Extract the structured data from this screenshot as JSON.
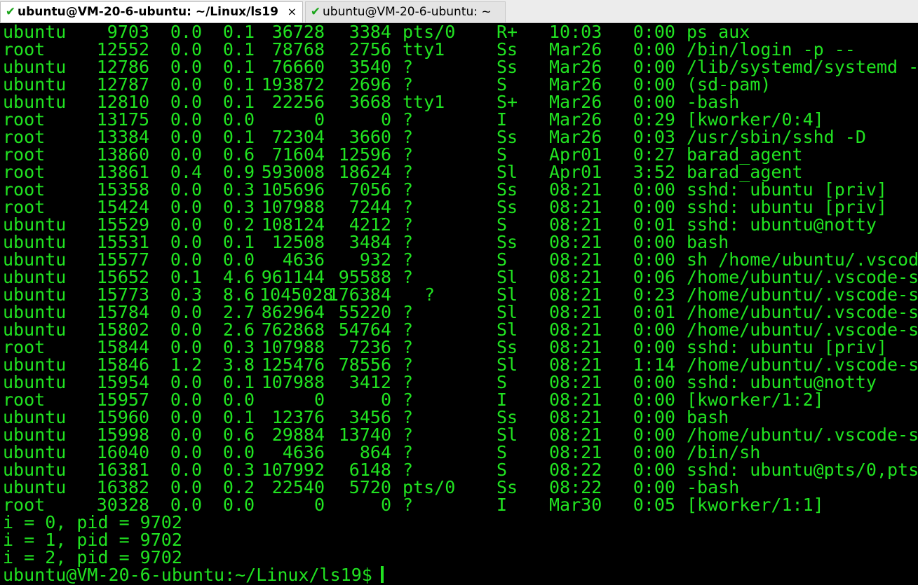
{
  "tabs": [
    {
      "title": "ubuntu@VM-20-6-ubuntu: ~/Linux/ls19",
      "status_icon": "check-icon",
      "close": "×",
      "active": true
    },
    {
      "title": "ubuntu@VM-20-6-ubuntu: ~",
      "status_icon": "check-icon",
      "active": false
    }
  ],
  "colors": {
    "fg": "#21e321",
    "bg": "#000000",
    "tab_check": "#1aa51a"
  },
  "rows": [
    {
      "user": "ubuntu",
      "pid": "9703",
      "cpu": "0.0",
      "mem": "0.1",
      "vsz": "36728",
      "rss": "3384",
      "tty": "pts/0",
      "stat": "R+",
      "start": "10:03",
      "time": "0:00",
      "cmd": "ps aux"
    },
    {
      "user": "root",
      "pid": "12552",
      "cpu": "0.0",
      "mem": "0.1",
      "vsz": "78768",
      "rss": "2756",
      "tty": "tty1",
      "stat": "Ss",
      "start": "Mar26",
      "time": "0:00",
      "cmd": "/bin/login -p --"
    },
    {
      "user": "ubuntu",
      "pid": "12786",
      "cpu": "0.0",
      "mem": "0.1",
      "vsz": "76660",
      "rss": "3540",
      "tty": "?",
      "stat": "Ss",
      "start": "Mar26",
      "time": "0:00",
      "cmd": "/lib/systemd/systemd -"
    },
    {
      "user": "ubuntu",
      "pid": "12787",
      "cpu": "0.0",
      "mem": "0.1",
      "vsz": "193872",
      "rss": "2696",
      "tty": "?",
      "stat": "S",
      "start": "Mar26",
      "time": "0:00",
      "cmd": "(sd-pam)"
    },
    {
      "user": "ubuntu",
      "pid": "12810",
      "cpu": "0.0",
      "mem": "0.1",
      "vsz": "22256",
      "rss": "3668",
      "tty": "tty1",
      "stat": "S+",
      "start": "Mar26",
      "time": "0:00",
      "cmd": "-bash"
    },
    {
      "user": "root",
      "pid": "13175",
      "cpu": "0.0",
      "mem": "0.0",
      "vsz": "0",
      "rss": "0",
      "tty": "?",
      "stat": "I",
      "start": "Mar26",
      "time": "0:29",
      "cmd": "[kworker/0:4]"
    },
    {
      "user": "root",
      "pid": "13384",
      "cpu": "0.0",
      "mem": "0.1",
      "vsz": "72304",
      "rss": "3660",
      "tty": "?",
      "stat": "Ss",
      "start": "Mar26",
      "time": "0:03",
      "cmd": "/usr/sbin/sshd -D"
    },
    {
      "user": "root",
      "pid": "13860",
      "cpu": "0.0",
      "mem": "0.6",
      "vsz": "71604",
      "rss": "12596",
      "tty": "?",
      "stat": "S",
      "start": "Apr01",
      "time": "0:27",
      "cmd": "barad_agent"
    },
    {
      "user": "root",
      "pid": "13861",
      "cpu": "0.4",
      "mem": "0.9",
      "vsz": "593008",
      "rss": "18624",
      "tty": "?",
      "stat": "Sl",
      "start": "Apr01",
      "time": "3:52",
      "cmd": "barad_agent"
    },
    {
      "user": "root",
      "pid": "15358",
      "cpu": "0.0",
      "mem": "0.3",
      "vsz": "105696",
      "rss": "7056",
      "tty": "?",
      "stat": "Ss",
      "start": "08:21",
      "time": "0:00",
      "cmd": "sshd: ubuntu [priv]"
    },
    {
      "user": "root",
      "pid": "15424",
      "cpu": "0.0",
      "mem": "0.3",
      "vsz": "107988",
      "rss": "7244",
      "tty": "?",
      "stat": "Ss",
      "start": "08:21",
      "time": "0:00",
      "cmd": "sshd: ubuntu [priv]"
    },
    {
      "user": "ubuntu",
      "pid": "15529",
      "cpu": "0.0",
      "mem": "0.2",
      "vsz": "108124",
      "rss": "4212",
      "tty": "?",
      "stat": "S",
      "start": "08:21",
      "time": "0:01",
      "cmd": "sshd: ubuntu@notty"
    },
    {
      "user": "ubuntu",
      "pid": "15531",
      "cpu": "0.0",
      "mem": "0.1",
      "vsz": "12508",
      "rss": "3484",
      "tty": "?",
      "stat": "Ss",
      "start": "08:21",
      "time": "0:00",
      "cmd": "bash"
    },
    {
      "user": "ubuntu",
      "pid": "15577",
      "cpu": "0.0",
      "mem": "0.0",
      "vsz": "4636",
      "rss": "932",
      "tty": "?",
      "stat": "S",
      "start": "08:21",
      "time": "0:00",
      "cmd": "sh /home/ubuntu/.vscod"
    },
    {
      "user": "ubuntu",
      "pid": "15652",
      "cpu": "0.1",
      "mem": "4.6",
      "vsz": "961144",
      "rss": "95588",
      "tty": "?",
      "stat": "Sl",
      "start": "08:21",
      "time": "0:06",
      "cmd": "/home/ubuntu/.vscode-s"
    },
    {
      "user": "ubuntu",
      "pid": "15773",
      "cpu": "0.3",
      "mem": "8.6",
      "vsz": "1045028",
      "rss": "176384",
      "tty": "?",
      "stat": "Sl",
      "start": "08:21",
      "time": "0:23",
      "cmd": "/home/ubuntu/.vscode-s",
      "wide": true
    },
    {
      "user": "ubuntu",
      "pid": "15784",
      "cpu": "0.0",
      "mem": "2.7",
      "vsz": "862964",
      "rss": "55220",
      "tty": "?",
      "stat": "Sl",
      "start": "08:21",
      "time": "0:01",
      "cmd": "/home/ubuntu/.vscode-s"
    },
    {
      "user": "ubuntu",
      "pid": "15802",
      "cpu": "0.0",
      "mem": "2.6",
      "vsz": "762868",
      "rss": "54764",
      "tty": "?",
      "stat": "Sl",
      "start": "08:21",
      "time": "0:00",
      "cmd": "/home/ubuntu/.vscode-s"
    },
    {
      "user": "root",
      "pid": "15844",
      "cpu": "0.0",
      "mem": "0.3",
      "vsz": "107988",
      "rss": "7236",
      "tty": "?",
      "stat": "Ss",
      "start": "08:21",
      "time": "0:00",
      "cmd": "sshd: ubuntu [priv]"
    },
    {
      "user": "ubuntu",
      "pid": "15846",
      "cpu": "1.2",
      "mem": "3.8",
      "vsz": "125476",
      "rss": "78556",
      "tty": "?",
      "stat": "Sl",
      "start": "08:21",
      "time": "1:14",
      "cmd": "/home/ubuntu/.vscode-s"
    },
    {
      "user": "ubuntu",
      "pid": "15954",
      "cpu": "0.0",
      "mem": "0.1",
      "vsz": "107988",
      "rss": "3412",
      "tty": "?",
      "stat": "S",
      "start": "08:21",
      "time": "0:00",
      "cmd": "sshd: ubuntu@notty"
    },
    {
      "user": "root",
      "pid": "15957",
      "cpu": "0.0",
      "mem": "0.0",
      "vsz": "0",
      "rss": "0",
      "tty": "?",
      "stat": "I",
      "start": "08:21",
      "time": "0:00",
      "cmd": "[kworker/1:2]"
    },
    {
      "user": "ubuntu",
      "pid": "15960",
      "cpu": "0.0",
      "mem": "0.1",
      "vsz": "12376",
      "rss": "3456",
      "tty": "?",
      "stat": "Ss",
      "start": "08:21",
      "time": "0:00",
      "cmd": "bash"
    },
    {
      "user": "ubuntu",
      "pid": "15998",
      "cpu": "0.0",
      "mem": "0.6",
      "vsz": "29884",
      "rss": "13740",
      "tty": "?",
      "stat": "Sl",
      "start": "08:21",
      "time": "0:00",
      "cmd": "/home/ubuntu/.vscode-s"
    },
    {
      "user": "ubuntu",
      "pid": "16040",
      "cpu": "0.0",
      "mem": "0.0",
      "vsz": "4636",
      "rss": "864",
      "tty": "?",
      "stat": "S",
      "start": "08:21",
      "time": "0:00",
      "cmd": "/bin/sh"
    },
    {
      "user": "ubuntu",
      "pid": "16381",
      "cpu": "0.0",
      "mem": "0.3",
      "vsz": "107992",
      "rss": "6148",
      "tty": "?",
      "stat": "S",
      "start": "08:22",
      "time": "0:00",
      "cmd": "sshd: ubuntu@pts/0,pts"
    },
    {
      "user": "ubuntu",
      "pid": "16382",
      "cpu": "0.0",
      "mem": "0.2",
      "vsz": "22540",
      "rss": "5720",
      "tty": "pts/0",
      "stat": "Ss",
      "start": "08:22",
      "time": "0:00",
      "cmd": "-bash"
    },
    {
      "user": "root",
      "pid": "30328",
      "cpu": "0.0",
      "mem": "0.0",
      "vsz": "0",
      "rss": "0",
      "tty": "?",
      "stat": "I",
      "start": "Mar30",
      "time": "0:05",
      "cmd": "[kworker/1:1]"
    }
  ],
  "output_lines": [
    "i = 0, pid = 9702",
    "i = 1, pid = 9702",
    "i = 2, pid = 9702"
  ],
  "prompt": "ubuntu@VM-20-6-ubuntu:~/Linux/ls19$ "
}
